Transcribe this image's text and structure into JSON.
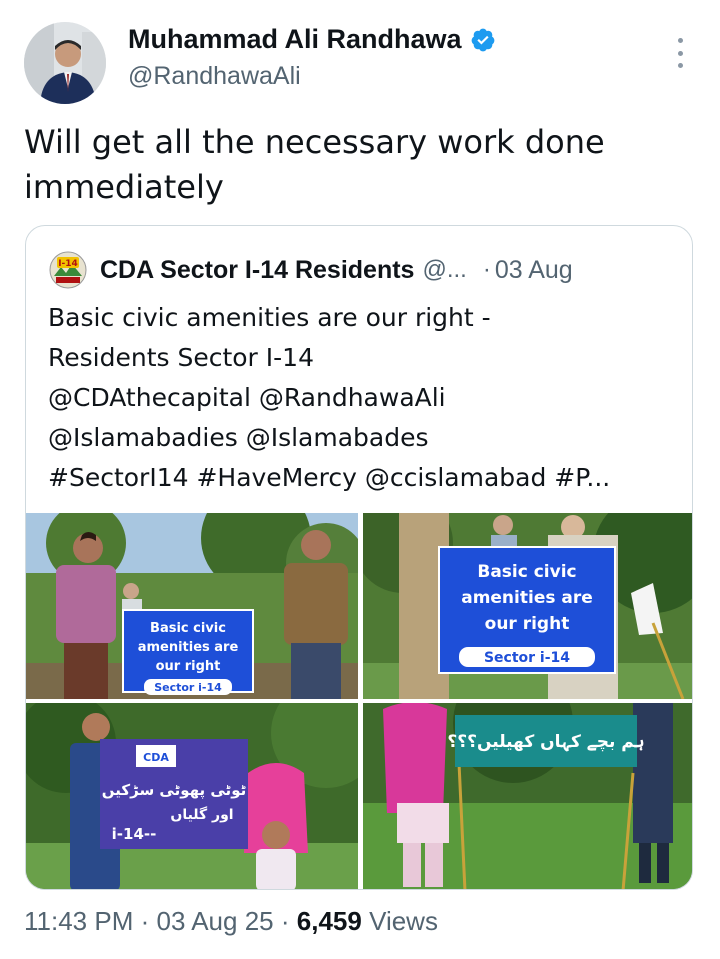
{
  "author": {
    "name": "Muhammad Ali Randhawa",
    "handle": "@RandhawaAli",
    "verified": true
  },
  "tweet": {
    "text_lines": [
      "Will get all the necessary work done",
      "immediately"
    ]
  },
  "quoted": {
    "avatar_text": "I-14",
    "name": "CDA Sector I-14 Residents",
    "handle": "@...",
    "dot": "·",
    "date": "03 Aug",
    "lines": [
      "Basic civic amenities are our right -",
      "Residents Sector I-14",
      "@CDAthecapital @RandhawaAli",
      "@Islamabadies @Islamabades",
      "#SectorI14 #HaveMercy @ccislamabad #P..."
    ],
    "photos": [
      {
        "sign_lines": [
          "Basic civic",
          "amenities are",
          "our right"
        ],
        "sign_footer": "Sector i-14"
      },
      {
        "sign_lines": [
          "Basic civic",
          "amenities are",
          "our right"
        ],
        "sign_footer": "Sector i-14"
      },
      {
        "sign_logo": "CDA",
        "sign_lines": [
          "ٹوٹی پھوٹی سڑکیں",
          "اور گلیاں"
        ],
        "sign_footer": "i-14--"
      },
      {
        "sign_lines": [
          "ہم بچے کہاں کھیلیں؟؟؟"
        ]
      }
    ]
  },
  "meta": {
    "time": "11:43 PM",
    "sep1": "·",
    "date": "03 Aug 25",
    "sep2": "·",
    "views_count": "6,459",
    "views_label": "Views"
  },
  "colors": {
    "text": "#0f1419",
    "secondary": "#536471",
    "verified": "#1d9bf0",
    "border": "#cfd9de",
    "sign_blue": "#1e4fd8",
    "sign_purple": "#4a3fa8",
    "sign_teal": "#1a8c8c"
  }
}
